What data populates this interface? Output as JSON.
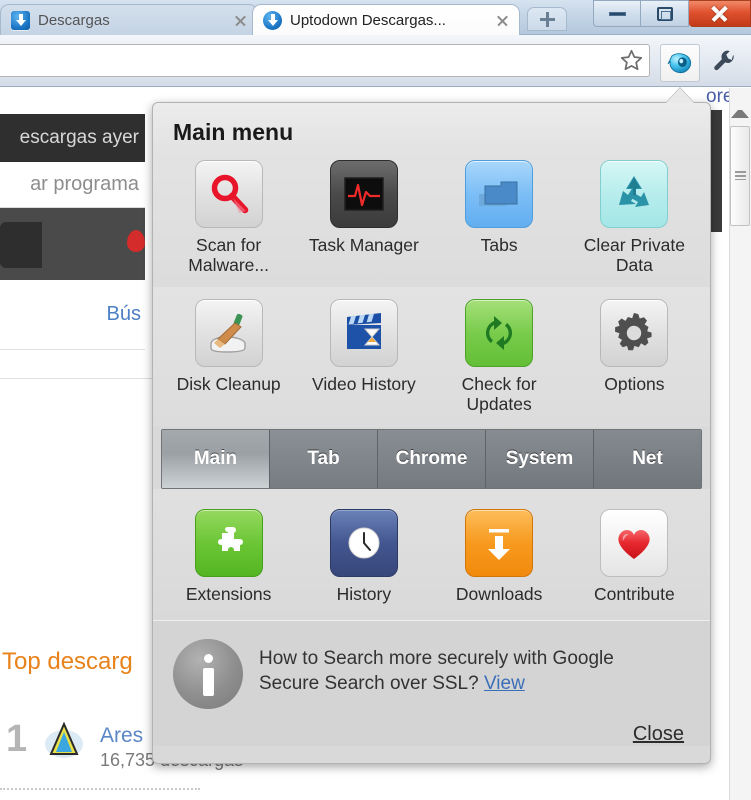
{
  "window": {
    "controls": {
      "minimize": "minimize-button",
      "restore": "restore-button",
      "close": "close-button"
    }
  },
  "tabs": [
    {
      "title": "Descargas",
      "active": false,
      "favicon": "download-favicon"
    },
    {
      "title": "Uptodown Descargas...",
      "active": true,
      "favicon": "download-favicon"
    }
  ],
  "new_tab_label": "+",
  "toolbar": {
    "star": "bookmark-star-icon",
    "extension": "extension-icon",
    "wrench": "wrench-icon"
  },
  "page": {
    "dark_bar_text": "escargas ayer",
    "search_placeholder": "ar programa",
    "search_link": "Bús",
    "top_downloads_title": "Top descarg",
    "rank": "1",
    "app_name": "Ares",
    "app_downloads": "16,735 descargas",
    "right_link": "ores"
  },
  "popup": {
    "title": "Main menu",
    "top_items": [
      {
        "label": "Scan for Malware...",
        "icon": "magnifier-icon",
        "tile": "tile-grey"
      },
      {
        "label": "Task Manager",
        "icon": "heartbeat-monitor-icon",
        "tile": "tile-dark"
      },
      {
        "label": "Tabs",
        "icon": "tabs-icon",
        "tile": "tile-blue"
      },
      {
        "label": "Clear Private Data",
        "icon": "recycle-icon",
        "tile": "tile-cyan"
      },
      {
        "label": "Disk Cleanup",
        "icon": "broom-icon",
        "tile": "tile-grey"
      },
      {
        "label": "Video History",
        "icon": "video-clapper-icon",
        "tile": "tile-grey"
      },
      {
        "label": "Check for Updates",
        "icon": "refresh-arrows-icon",
        "tile": "tile-green"
      },
      {
        "label": "Options",
        "icon": "gear-icon",
        "tile": "tile-grey"
      }
    ],
    "menu_tabs": [
      {
        "label": "Main",
        "selected": true
      },
      {
        "label": "Tab",
        "selected": false
      },
      {
        "label": "Chrome",
        "selected": false
      },
      {
        "label": "System",
        "selected": false
      },
      {
        "label": "Net",
        "selected": false
      }
    ],
    "bottom_items": [
      {
        "label": "Extensions",
        "icon": "puzzle-piece-icon",
        "tile": "tile-greenx"
      },
      {
        "label": "History",
        "icon": "clock-icon",
        "tile": "tile-navy"
      },
      {
        "label": "Downloads",
        "icon": "download-arrow-icon",
        "tile": "tile-orange"
      },
      {
        "label": "Contribute",
        "icon": "heart-icon",
        "tile": "tile-white"
      }
    ],
    "info": {
      "icon": "info-circle-icon",
      "text_line1": "How to Search more securely with Google",
      "text_line2": "Secure Search over SSL? ",
      "link": "View"
    },
    "close_label": "Close"
  },
  "colors": {
    "panel_bg": "#d9d9d9",
    "accent_orange": "#e8821a",
    "link_blue": "#3b6fb8",
    "close_red": "#e0522f"
  }
}
